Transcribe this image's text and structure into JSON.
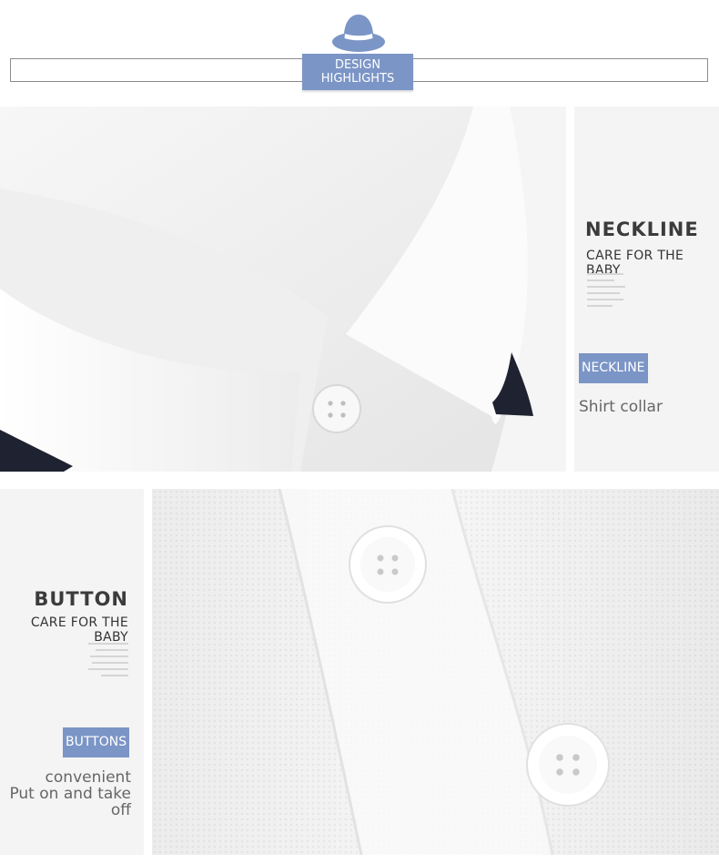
{
  "header": {
    "badge_line1": "DESIGN",
    "badge_line2": "HIGHLIGHTS",
    "icon": "hat-icon",
    "accent": "#7b95c6"
  },
  "neckline": {
    "title": "NECKLINE",
    "subtitle": "CARE FOR THE BABY",
    "tag": "NECKLINE",
    "description": "Shirt collar"
  },
  "button": {
    "title": "BUTTON",
    "subtitle": "CARE FOR THE BABY",
    "tag": "BUTTONS",
    "description_line1": "convenient",
    "description_line2": "Put on and take",
    "description_line3": "off"
  }
}
